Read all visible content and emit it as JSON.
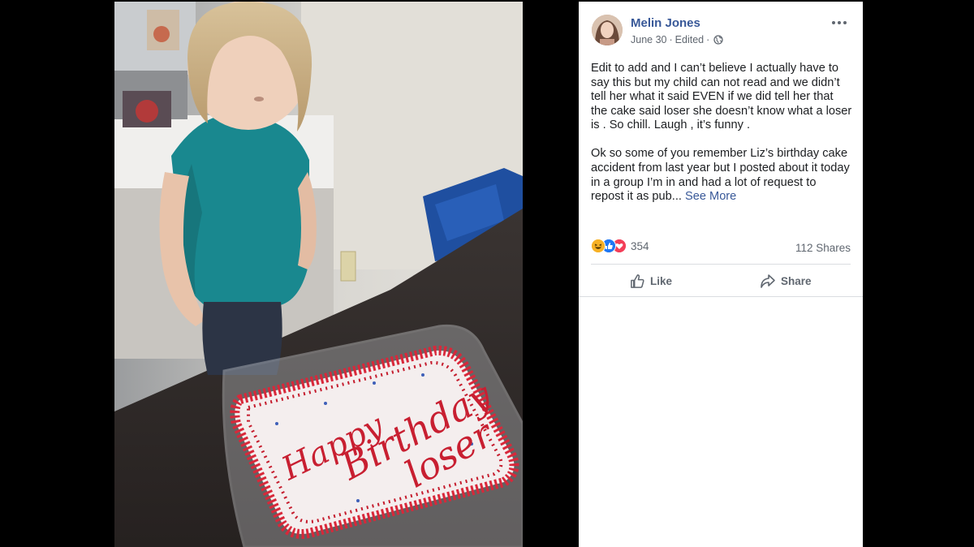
{
  "post": {
    "author": "Melin Jones",
    "date": "June 30",
    "separator1": "·",
    "edited": "Edited",
    "separator2": "·",
    "paragraphs": [
      "Edit to add and I can’t believe I actually have to say this but my child can not read and we didn’t tell her what it said EVEN if we did tell her that the cake said loser she doesn’t know what a loser is . So chill. Laugh , it’s funny .",
      "Ok so some of you remember Liz’s birthday cake accident from last year but I posted about it today in a group I’m in and had a lot of request to repost it as pub..."
    ],
    "see_more": "See More",
    "reaction_count": "354",
    "reaction_icons": [
      "haha-icon",
      "like-icon",
      "love-icon"
    ],
    "shares": "112 Shares",
    "like_label": "Like",
    "share_label": "Share"
  },
  "photo": {
    "cake_text": [
      "Happy",
      "Birthday",
      "loser"
    ],
    "cake_icing_color": "#d8283a"
  },
  "colors": {
    "link": "#385898",
    "secondary_text": "#606770",
    "text": "#1c1e21",
    "haha": "#f7b125",
    "like": "#2078f4",
    "love": "#f33e58"
  }
}
